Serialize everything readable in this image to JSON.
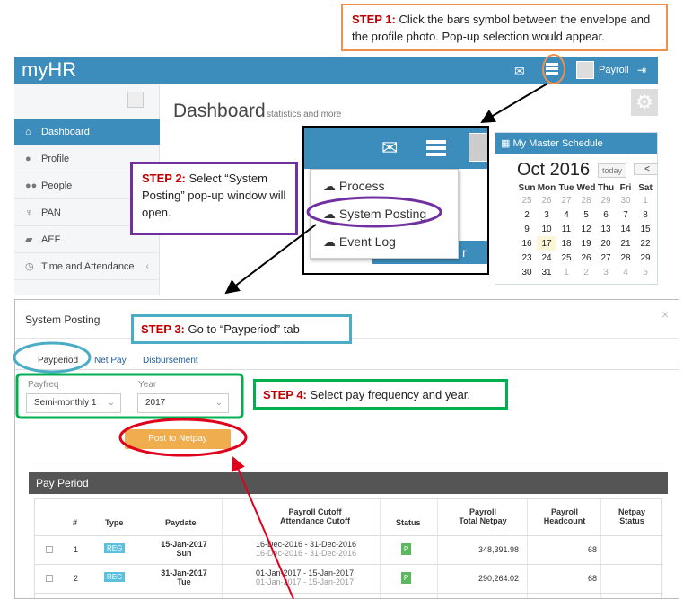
{
  "steps": {
    "step1": {
      "label": "STEP 1:",
      "text": "Click the bars symbol between the envelope and the profile photo. Pop-up selection would appear."
    },
    "step2": {
      "label": "STEP 2:",
      "text": "Select “System Posting” pop-up window will open."
    },
    "step3": {
      "label": "STEP 3:",
      "text": "Go to “Payperiod” tab"
    },
    "step4": {
      "label": "STEP 4:",
      "text": "Select pay frequency and year."
    }
  },
  "app": {
    "brand": "myHR",
    "user": "Payroll",
    "page_title": "Dashboard",
    "page_subtitle": "statistics and more",
    "sidebar": [
      "Dashboard",
      "Profile",
      "People",
      "PAN",
      "AEF",
      "Time and Attendance"
    ],
    "schedule": {
      "title": "My Master Schedule",
      "month": "Oct 2016",
      "today": "today",
      "prev": "<",
      "days": [
        "Sun",
        "Mon",
        "Tue",
        "Wed",
        "Thu",
        "Fri",
        "Sat"
      ],
      "weeks": [
        [
          "25",
          "26",
          "27",
          "28",
          "29",
          "30",
          "1"
        ],
        [
          "2",
          "3",
          "4",
          "5",
          "6",
          "7",
          "8"
        ],
        [
          "9",
          "10",
          "11",
          "12",
          "13",
          "14",
          "15"
        ],
        [
          "16",
          "17",
          "18",
          "19",
          "20",
          "21",
          "22"
        ],
        [
          "23",
          "24",
          "25",
          "26",
          "27",
          "28",
          "29"
        ],
        [
          "30",
          "31",
          "1",
          "2",
          "3",
          "4",
          "5"
        ]
      ]
    }
  },
  "popup": {
    "items": [
      "Process",
      "System Posting",
      "Event Log"
    ],
    "behind_text": "r Sched"
  },
  "modal": {
    "title": "System Posting",
    "close": "×",
    "tabs": [
      "Payperiod",
      "Net Pay",
      "Disbursement"
    ],
    "payfreq_label": "Payfreq",
    "payfreq_value": "Semi-monthly 1",
    "year_label": "Year",
    "year_value": "2017",
    "post_button": "Post to Netpay",
    "pay_period_title": "Pay Period",
    "columns": {
      "num": "#",
      "type": "Type",
      "paydate": "Paydate",
      "cutoff1": "Payroll Cutoff",
      "cutoff2": "Attendance Cutoff",
      "status": "Status",
      "netpay1": "Payroll",
      "netpay2": "Total Netpay",
      "head1": "Payroll",
      "head2": "Headcount",
      "nstatus1": "Netpay",
      "nstatus2": "Status"
    },
    "rows": [
      {
        "num": "1",
        "type": "REG",
        "date": "15-Jan-2017",
        "day": "Sun",
        "cutoff": "16-Dec-2016 - 31-Dec-2016",
        "att": "16-Dec-2016 - 31-Dec-2016",
        "status": "P",
        "netpay": "348,391.98",
        "headcount": "68"
      },
      {
        "num": "2",
        "type": "REG",
        "date": "31-Jan-2017",
        "day": "Tue",
        "cutoff": "01-Jan-2017 - 15-Jan-2017",
        "att": "01-Jan-2017 - 15-Jan-2017",
        "status": "P",
        "netpay": "290,264.02",
        "headcount": "68"
      }
    ]
  },
  "colors": {
    "primary": "#3c8dbc",
    "step_label": "#c00000",
    "orange": "#f0ad4e"
  }
}
